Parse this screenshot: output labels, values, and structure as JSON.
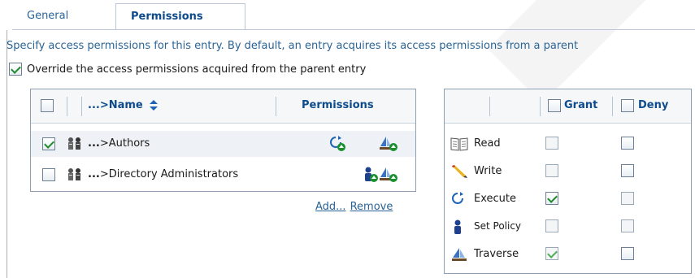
{
  "tabs": {
    "general": "General",
    "permissions": "Permissions"
  },
  "description": "Specify access permissions for this entry. By default, an entry acquires its access permissions from a parent",
  "override": {
    "label": "Override the access permissions acquired from the parent entry",
    "checked": true
  },
  "left_table": {
    "header": {
      "dots": "...",
      "name_label": ">Name",
      "sort_icon": "sort-updown-icon",
      "permissions_label": "Permissions"
    },
    "rows": [
      {
        "dots": "...",
        "name": ">Authors",
        "checked": true,
        "icons": [
          "execute-icon",
          "traverse-icon"
        ]
      },
      {
        "dots": "...",
        "name": ">Directory Administrators",
        "checked": false,
        "icons": [
          "set-policy-icon",
          "traverse-icon"
        ]
      }
    ],
    "add_link": "Add...",
    "remove_link": "Remove"
  },
  "right_table": {
    "grant_label": "Grant",
    "deny_label": "Deny",
    "rows": [
      {
        "label": "Read",
        "icon": "book-icon",
        "grant": false,
        "deny": false
      },
      {
        "label": "Write",
        "icon": "pencil-icon",
        "grant": false,
        "deny": false
      },
      {
        "label": "Execute",
        "icon": "execute-icon",
        "grant": true,
        "deny": false
      },
      {
        "label": "Set Policy",
        "icon": "set-policy-icon",
        "grant": false,
        "deny": false
      },
      {
        "label": "Traverse",
        "icon": "traverse-icon",
        "grant": true,
        "deny": false
      }
    ]
  },
  "colors": {
    "link": "#2a6496",
    "tab_active": "#0e4b8c",
    "check": "#1f8a2d",
    "border": "#8e9fb3"
  }
}
